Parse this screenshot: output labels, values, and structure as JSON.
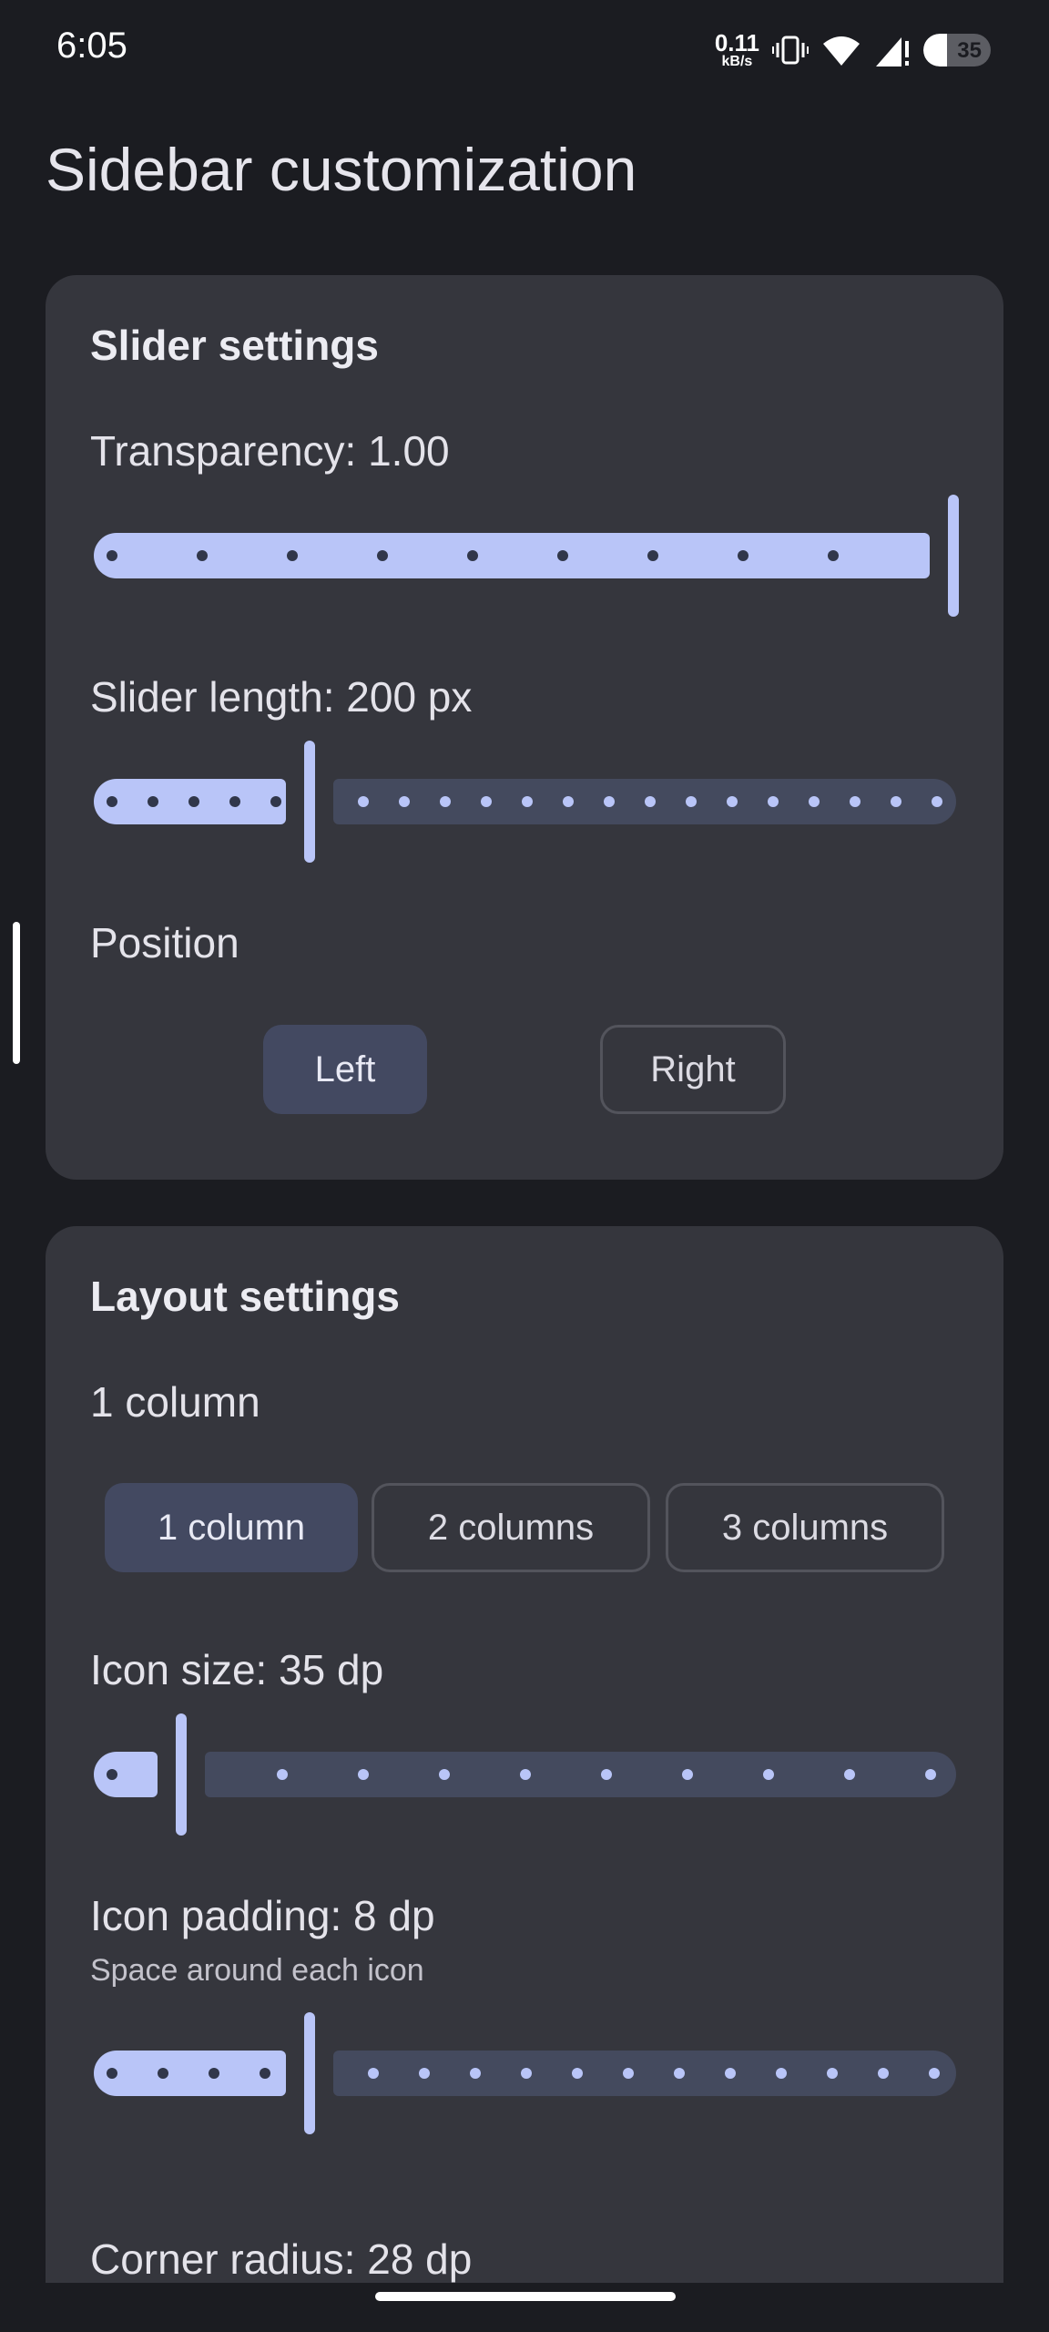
{
  "status_bar": {
    "time": "6:05",
    "net_speed_value": "0.11",
    "net_speed_unit": "kB/s",
    "battery_percent": "35",
    "icons": [
      "vibrate-icon",
      "wifi-icon",
      "signal-icon",
      "battery-icon"
    ]
  },
  "page": {
    "title": "Sidebar customization"
  },
  "slider_settings": {
    "title": "Slider settings",
    "transparency": {
      "label": "Transparency: 1.00",
      "value": 1.0,
      "min": 0.0,
      "max": 1.0,
      "steps": 10
    },
    "slider_length": {
      "label": "Slider length: 200 px",
      "value_fraction": 0.25,
      "steps": 20
    },
    "position": {
      "label": "Position",
      "options": [
        "Left",
        "Right"
      ],
      "selected": "Left"
    }
  },
  "layout_settings": {
    "title": "Layout settings",
    "columns_label": "1 column",
    "columns": {
      "options": [
        "1 column",
        "2 columns",
        "3 columns"
      ],
      "selected": "1 column"
    },
    "icon_size": {
      "label": "Icon size: 35 dp",
      "value_fraction": 0.1,
      "steps": 10
    },
    "icon_padding": {
      "label": "Icon padding: 8 dp",
      "sublabel": "Space around each icon",
      "value_fraction": 0.25,
      "steps": 16
    },
    "corner_radius": {
      "label": "Corner radius: 28 dp"
    }
  },
  "colors": {
    "background": "#1b1c21",
    "card": "#35363d",
    "accent": "#b9c5f8",
    "inactive_track": "#444a5e",
    "selected_button": "#434961"
  }
}
